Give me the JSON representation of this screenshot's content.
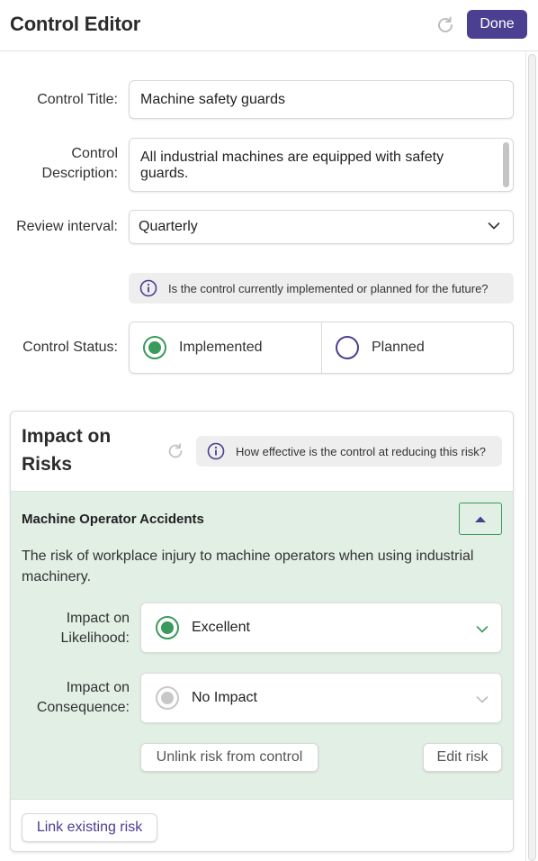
{
  "header": {
    "title": "Control Editor",
    "refresh_icon": "refresh-icon",
    "done_label": "Done"
  },
  "form": {
    "title_label": "Control Title:",
    "title_value": "Machine safety guards",
    "description_label_line1": "Control",
    "description_label_line2": "Description:",
    "description_value": "All industrial machines are equipped with safety guards.",
    "review_label": "Review interval:",
    "review_value": "Quarterly",
    "status_info": "Is the control currently implemented or planned for the future?",
    "status_label": "Control Status:",
    "status_options": [
      {
        "label": "Implemented",
        "selected": true
      },
      {
        "label": "Planned",
        "selected": false
      }
    ]
  },
  "impact": {
    "title": "Impact on Risks",
    "info": "How effective is the control at reducing this risk?",
    "risk": {
      "name": "Machine Operator Accidents",
      "description": "The risk of workplace injury to machine operators when using industrial machinery.",
      "likelihood_label_line1": "Impact on",
      "likelihood_label_line2": "Likelihood:",
      "likelihood_value": "Excellent",
      "consequence_label_line1": "Impact on",
      "consequence_label_line2": "Consequence:",
      "consequence_value": "No Impact",
      "unlink_label": "Unlink risk from control",
      "edit_label": "Edit risk"
    },
    "link_label": "Link existing risk"
  },
  "colors": {
    "accent": "#4a3f91",
    "success": "#3a9a5c",
    "risk_card_bg": "#e1efe5"
  }
}
